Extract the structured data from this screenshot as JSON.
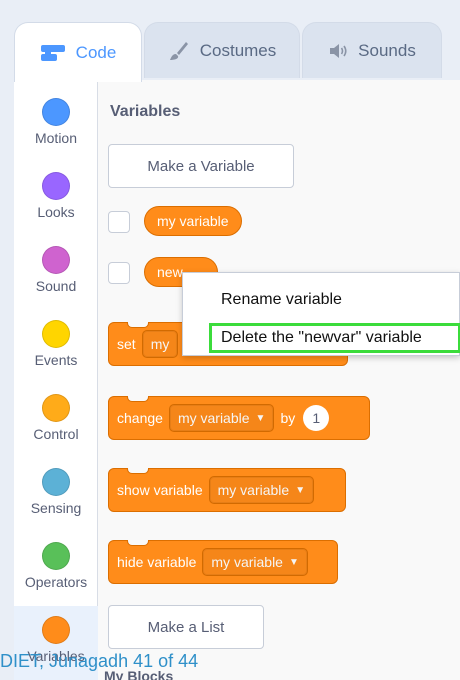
{
  "tabs": [
    {
      "label": "Code",
      "icon": "code-icon"
    },
    {
      "label": "Costumes",
      "icon": "brush-icon"
    },
    {
      "label": "Sounds",
      "icon": "speaker-icon"
    }
  ],
  "categories": [
    {
      "label": "Motion",
      "color": "#4c97ff"
    },
    {
      "label": "Looks",
      "color": "#9966ff"
    },
    {
      "label": "Sound",
      "color": "#cf63cf"
    },
    {
      "label": "Events",
      "color": "#ffd500"
    },
    {
      "label": "Control",
      "color": "#ffab19"
    },
    {
      "label": "Sensing",
      "color": "#5cb1d6"
    },
    {
      "label": "Operators",
      "color": "#59c059"
    },
    {
      "label": "Variables",
      "color": "#ff8c1a"
    }
  ],
  "palette": {
    "section_title": "Variables",
    "make_variable_label": "Make a Variable",
    "variables": [
      "my variable",
      "newvar"
    ],
    "variable_shown_truncated": "new",
    "set_block": {
      "verb": "set",
      "var_truncated": "my"
    },
    "change_block": {
      "verb": "change",
      "var": "my variable",
      "by": "by",
      "value": "1"
    },
    "show_block": {
      "verb": "show variable",
      "var": "my variable"
    },
    "hide_block": {
      "verb": "hide variable",
      "var": "my variable"
    },
    "make_list_label": "Make a List",
    "next_section_partial": "My Blocks"
  },
  "context_menu": {
    "items": [
      "Rename variable",
      "Delete the \"newvar\" variable"
    ],
    "highlight_color": "#3bdc3b"
  },
  "footer": {
    "text": "DIET, Junagadh 41 of 44"
  },
  "colors": {
    "accent": "#4c97ff",
    "variables": "#ff8c1a"
  }
}
